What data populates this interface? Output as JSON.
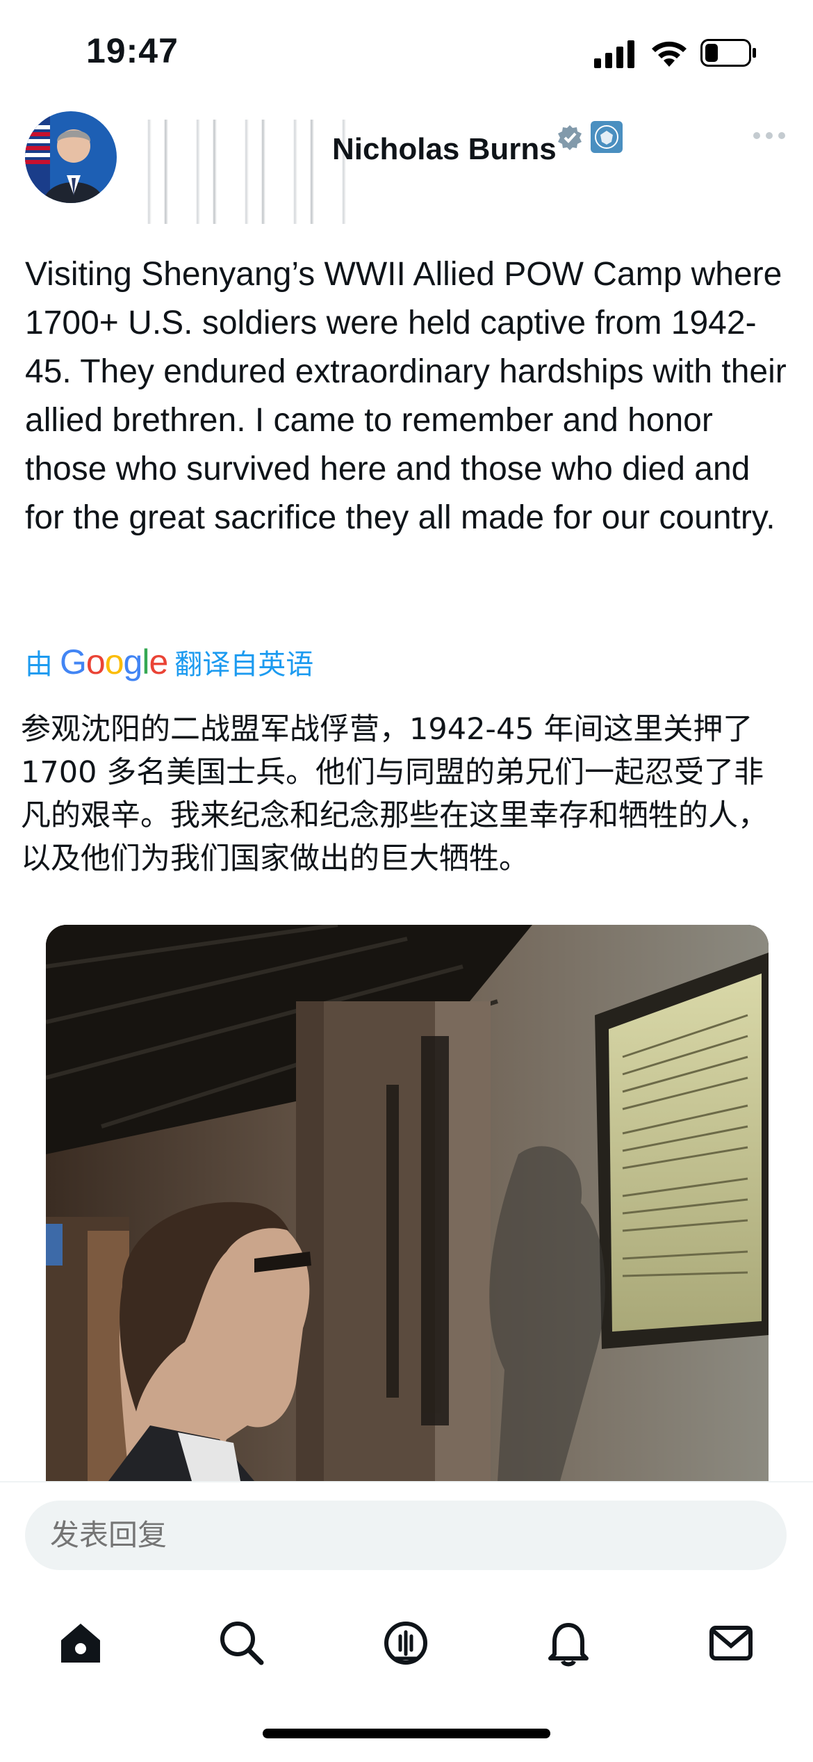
{
  "status_bar": {
    "time": "19:47",
    "signal_icon": "cellular-signal-icon",
    "wifi_icon": "wifi-icon",
    "battery_icon": "battery-icon",
    "battery_level": 0.3
  },
  "post": {
    "author_name": "Nicholas Burns",
    "author_name_visible_fragment": "Nicholas Burns",
    "verified_icon": "verified-badge-icon",
    "affiliation_icon": "government-seal-icon",
    "more_icon": "more-options-icon",
    "text": "Visiting Shenyang’s WWII Allied POW Camp where 1700+ U.S. soldiers were held captive from 1942-45.  They endured extraordinary hardships with their allied brethren.  I came to remember and honor those who survived here and those who died and for the great sacrifice they all made for our country.",
    "translate_prefix": "由",
    "translate_brand": "Google",
    "translate_suffix": "翻译自英语",
    "translated_text": "参观沈阳的二战盟军战俘营，1942-45 年间这里关押了 1700 多名美国士兵。他们与同盟的弟兄们一起忍受了非凡的艰辛。我来纪念和纪念那些在这里幸存和牺牲的人，以及他们为我们国家做出的巨大牺牲。"
  },
  "reply": {
    "placeholder": "发表回复"
  },
  "tab_bar": {
    "items": [
      {
        "icon": "home-icon"
      },
      {
        "icon": "search-icon"
      },
      {
        "icon": "spaces-icon"
      },
      {
        "icon": "notifications-icon"
      },
      {
        "icon": "messages-icon"
      }
    ]
  },
  "colors": {
    "accent": "#1d9bf0",
    "text": "#0f1419",
    "input_bg": "#eff3f4"
  }
}
